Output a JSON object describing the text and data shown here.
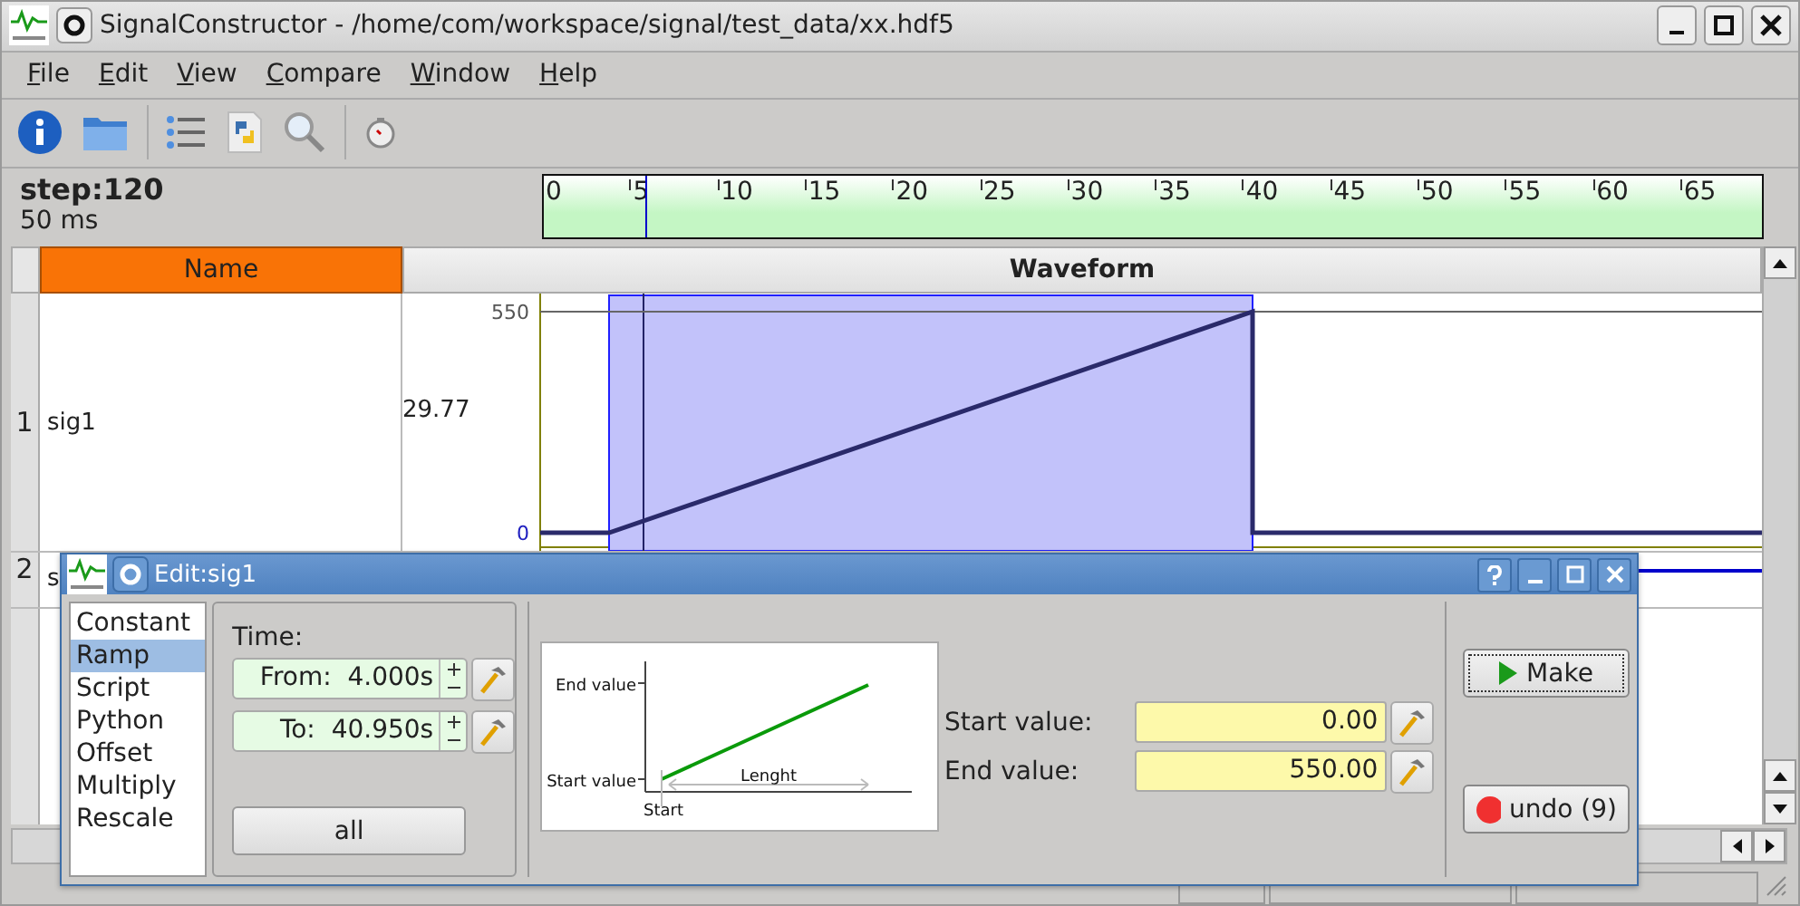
{
  "window": {
    "title": "SignalConstructor - /home/com/workspace/signal/test_data/xx.hdf5"
  },
  "menu": [
    "File",
    "Edit",
    "View",
    "Compare",
    "Window",
    "Help"
  ],
  "step": {
    "label": "step:120",
    "interval": "50 ms"
  },
  "ruler": {
    "labels": [
      "0",
      "5",
      "10",
      "15",
      "20",
      "25",
      "30",
      "35",
      "40",
      "45",
      "50",
      "55",
      "60",
      "65"
    ]
  },
  "table": {
    "columns": [
      {
        "label": "Name",
        "selected": true
      },
      {
        "label": "Waveform",
        "selected": false
      }
    ],
    "rows": [
      {
        "number": "1",
        "name": "sig1",
        "value": "29.77",
        "axis_labels": [
          "550",
          "0"
        ]
      },
      {
        "number": "2",
        "name": "s"
      }
    ]
  },
  "dialog": {
    "title": "Edit:sig1",
    "functions": [
      {
        "label": "Constant",
        "selected": false
      },
      {
        "label": "Ramp",
        "selected": true
      },
      {
        "label": "Script",
        "selected": false
      },
      {
        "label": "Python",
        "selected": false
      },
      {
        "label": "Offset",
        "selected": false
      },
      {
        "label": "Multiply",
        "selected": false
      },
      {
        "label": "Rescale",
        "selected": false
      }
    ],
    "time": {
      "label": "Time:",
      "from": {
        "label": "From:",
        "value": "4.000s"
      },
      "to": {
        "label": "To:",
        "value": "40.950s"
      },
      "all_button": "all"
    },
    "preview": {
      "end_label": "End value",
      "start_label": "Start value",
      "length_label": "Lenght",
      "start_axis_label": "Start"
    },
    "params": [
      {
        "label": "Start value:",
        "value": "0.00"
      },
      {
        "label": "End value:",
        "value": "550.00"
      }
    ],
    "make_button": "Make",
    "undo_button": "undo (9)"
  }
}
